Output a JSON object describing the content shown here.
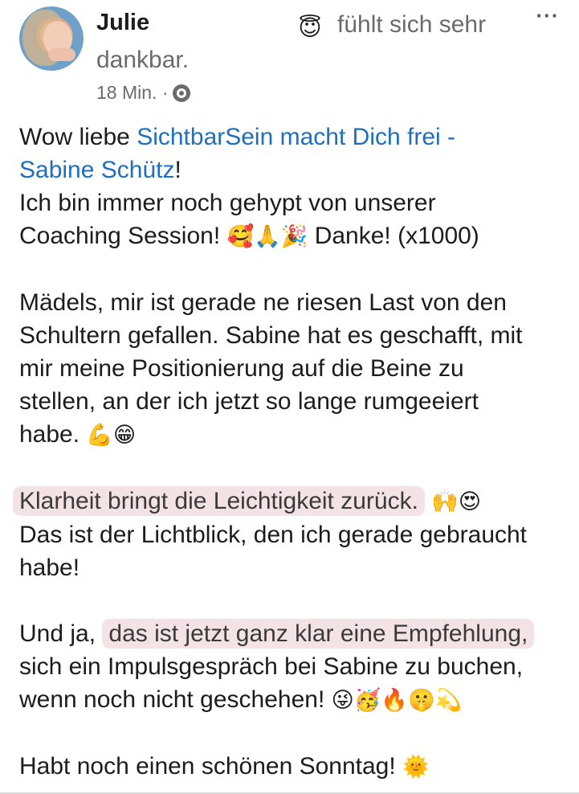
{
  "post": {
    "author": "Julie",
    "feeling_icon": "😇",
    "feeling_text_1": "fühlt sich sehr",
    "feeling_text_2": "dankbar.",
    "time": "18 Min. ·",
    "menu": "···",
    "p1": {
      "prefix": "Wow liebe ",
      "mention_1": "SichtbarSein macht Dich frei -",
      "mention_2": "Sabine Schütz",
      "suffix": "!"
    },
    "p2_line1": "Ich bin immer noch gehypt von unserer",
    "p2_line2_text": "Coaching Session!",
    "p2_line2_emojis": "🥰🙏🎉",
    "p2_line2_end": " Danke! (x1000)",
    "p3": [
      "Mädels, mir ist gerade ne riesen Last von den",
      "Schultern gefallen. Sabine hat es geschafft, mit",
      "mir meine Positionierung auf die Beine zu",
      "stellen, an der ich jetzt so lange rumgeeiert"
    ],
    "p3_last_text": "habe.",
    "p3_last_emojis": "💪😁",
    "p4_highlight": "Klarheit bringt die Leichtigkeit zurück.",
    "p4_emojis": "🙌😍",
    "p4_line2": "Das ist der Lichtblick, den ich gerade gebraucht",
    "p4_line3": "habe!",
    "p5_prefix": "Und ja, ",
    "p5_highlight": "das ist jetzt ganz klar eine Empfehlung,",
    "p5_line2": "sich ein Impulsgespräch bei Sabine zu buchen,",
    "p5_line3_text": "wenn noch nicht geschehen!",
    "p5_line3_emojis": "😜🥳🔥🤫💫",
    "p6_text": "Habt noch einen schönen Sonntag!",
    "p6_emoji": "🌞"
  }
}
